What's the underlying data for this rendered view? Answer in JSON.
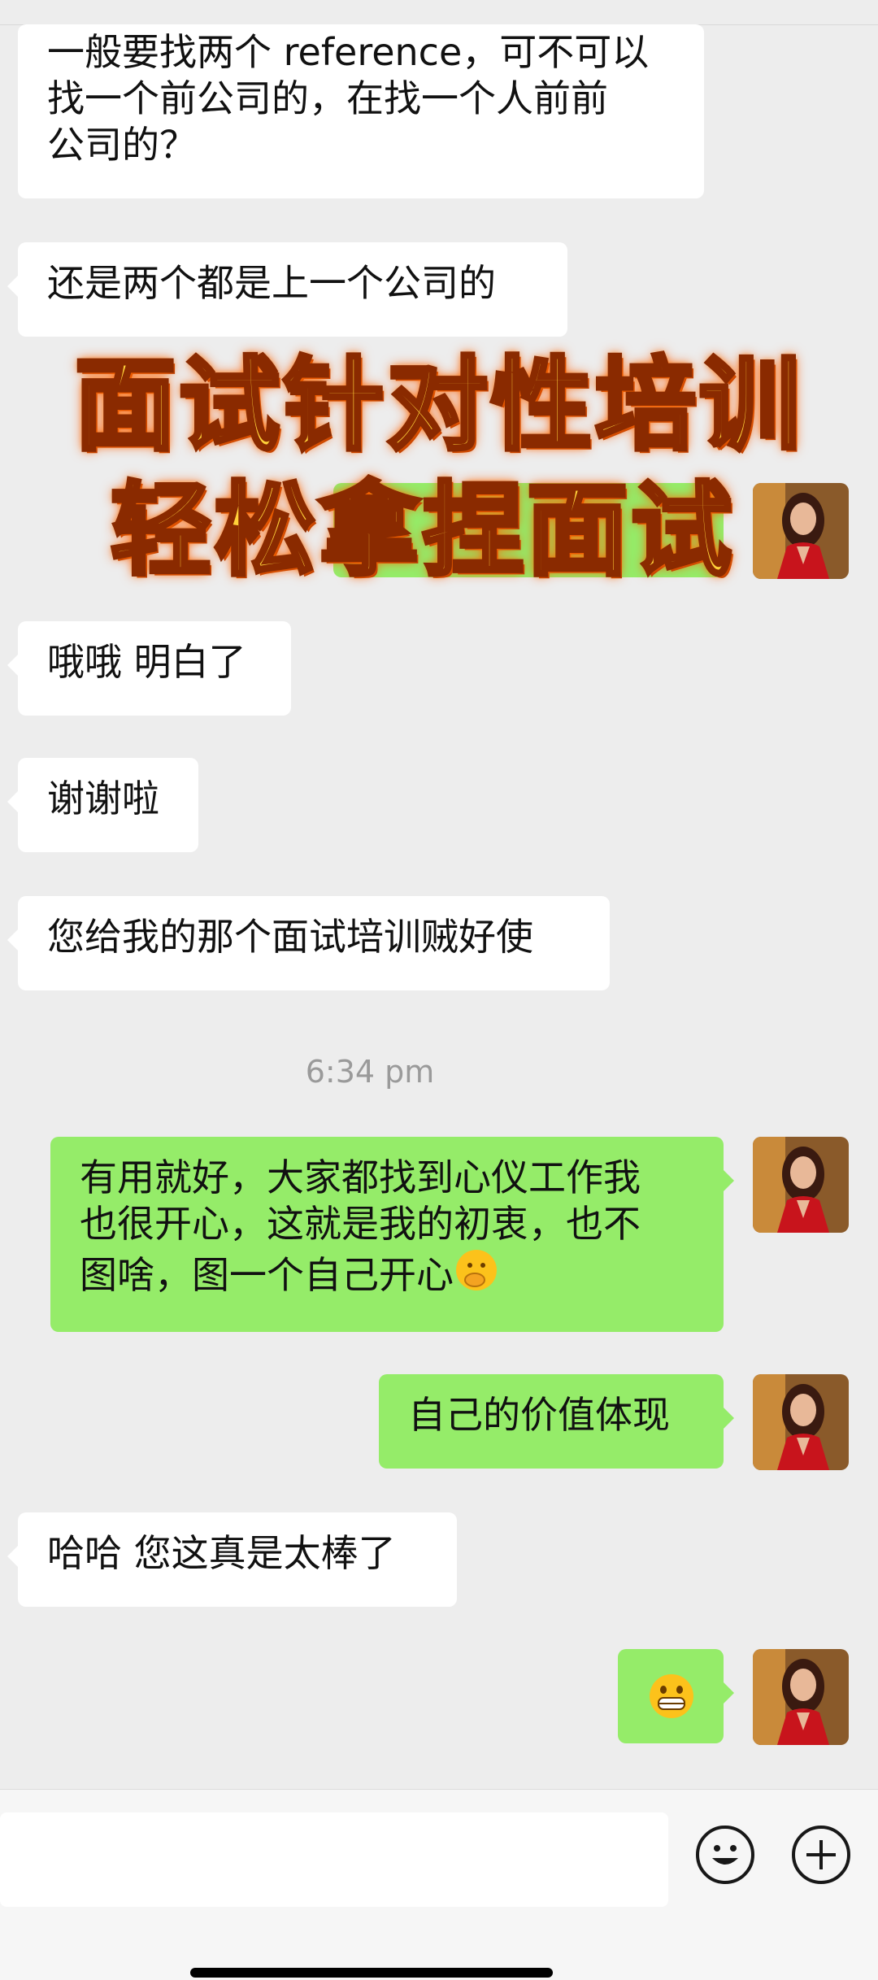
{
  "messages": [
    {
      "side": "in",
      "text": "一般要找两个reference，可不可以找一个前公司的，在找一个人前前公司的？"
    },
    {
      "side": "in",
      "text": "还是两个都是上一个公司的"
    },
    {
      "side": "in",
      "text": "哦哦 明白了"
    },
    {
      "side": "in",
      "text": "谢谢啦"
    },
    {
      "side": "in",
      "text": "您给我的那个面试培训贼好使"
    },
    {
      "side": "out",
      "text": "有用就好，大家都找到心仪工作我也很开心，这就是我的初衷，也不图啥，图一个自己开心"
    },
    {
      "side": "out",
      "text": "自己的价值体现"
    },
    {
      "side": "in",
      "text": "哈哈 您这真是太棒了"
    }
  ],
  "lines": {
    "m1": [
      "一般要找两个 reference，可不可以",
      "找一个前公司的，在找一个人前前",
      "公司的？"
    ],
    "m6": [
      "有用就好，大家都找到心仪工作我",
      "也很开心，这就是我的初衷，也不",
      "图啥，图一个自己开心"
    ]
  },
  "timestamp": "6:34 pm",
  "overlay": {
    "line1": "面试针对性培训",
    "line2": "轻松拿捏面试"
  },
  "icons": {
    "thinking_emoji": "face-with-hand-over-mouth",
    "grin_emoji": "grinning-face",
    "emoji_button": "smiley-face",
    "plus_button": "plus-circle"
  },
  "colors": {
    "outgoing_bubble": "#95ec69",
    "incoming_bubble": "#ffffff",
    "background": "#ededed",
    "banner_text": "#ffd23a"
  }
}
